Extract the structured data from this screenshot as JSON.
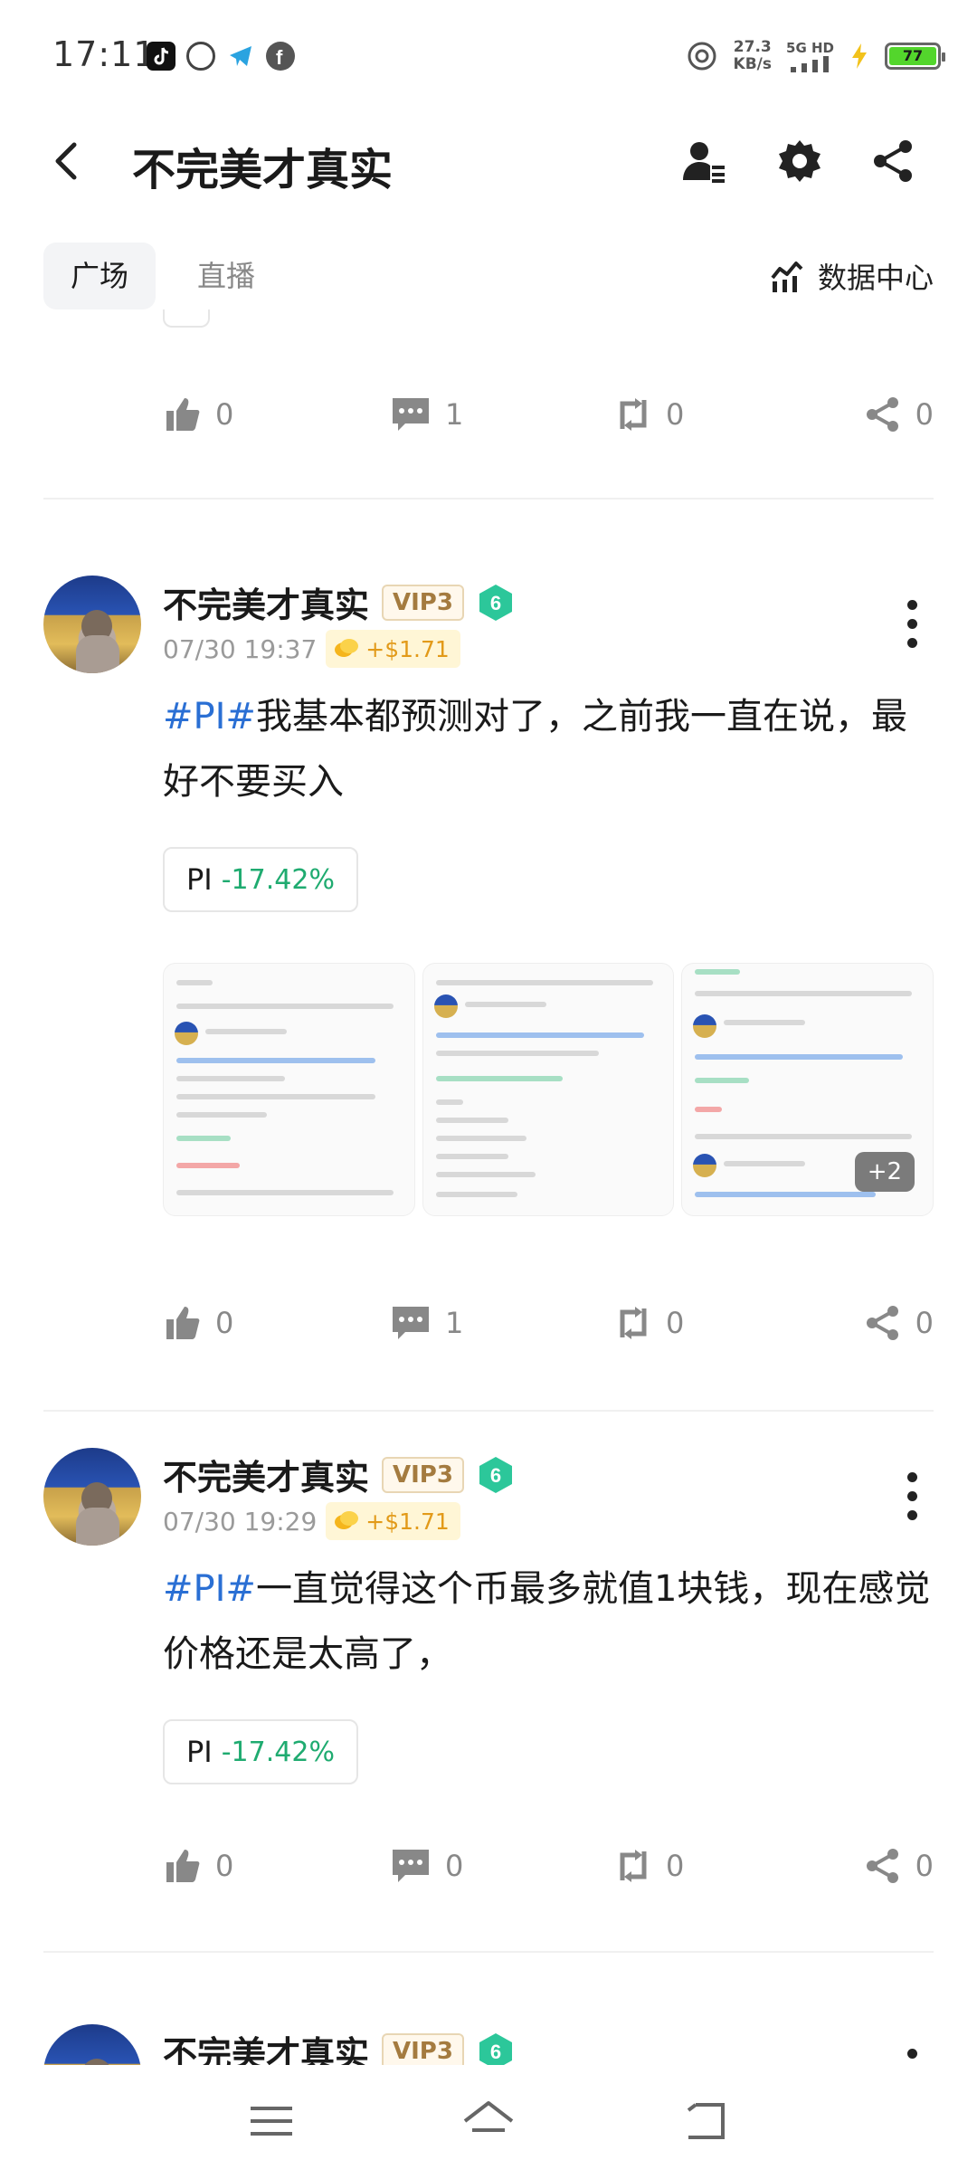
{
  "status_bar": {
    "time": "17:11",
    "net_speed_value": "27.3",
    "net_speed_unit": "KB/s",
    "net_type": "5G HD",
    "battery": "77"
  },
  "header": {
    "title": "不完美才真实"
  },
  "tabs": [
    {
      "label": "广场"
    },
    {
      "label": "直播"
    }
  ],
  "data_center_label": "数据中心",
  "top_post_actions": {
    "likes": "0",
    "comments": "1",
    "reposts": "0",
    "shares": "0"
  },
  "posts": [
    {
      "author": "不完美才真实",
      "vip": "VIP3",
      "level": "6",
      "time": "07/30 19:37",
      "reward": "+$1.71",
      "tag": "#PI#",
      "text": "我基本都预测对了，之前我一直在说，最好不要买入",
      "coin": {
        "symbol": "PI",
        "change": "-17.42%"
      },
      "more_images": "+2",
      "likes": "0",
      "comments": "1",
      "reposts": "0",
      "shares": "0"
    },
    {
      "author": "不完美才真实",
      "vip": "VIP3",
      "level": "6",
      "time": "07/30 19:29",
      "reward": "+$1.71",
      "tag": "#PI#",
      "text": "一直觉得这个币最多就值1块钱，现在感觉价格还是太高了，",
      "coin": {
        "symbol": "PI",
        "change": "-17.42%"
      },
      "likes": "0",
      "comments": "0",
      "reposts": "0",
      "shares": "0"
    },
    {
      "author": "不完美才真实",
      "vip": "VIP3",
      "level": "6"
    }
  ],
  "colors": {
    "accent_tag": "#2a6fd4",
    "negative_change": "#1fab70",
    "reward": "#e29a19",
    "level_badge": "#2cc79a"
  }
}
